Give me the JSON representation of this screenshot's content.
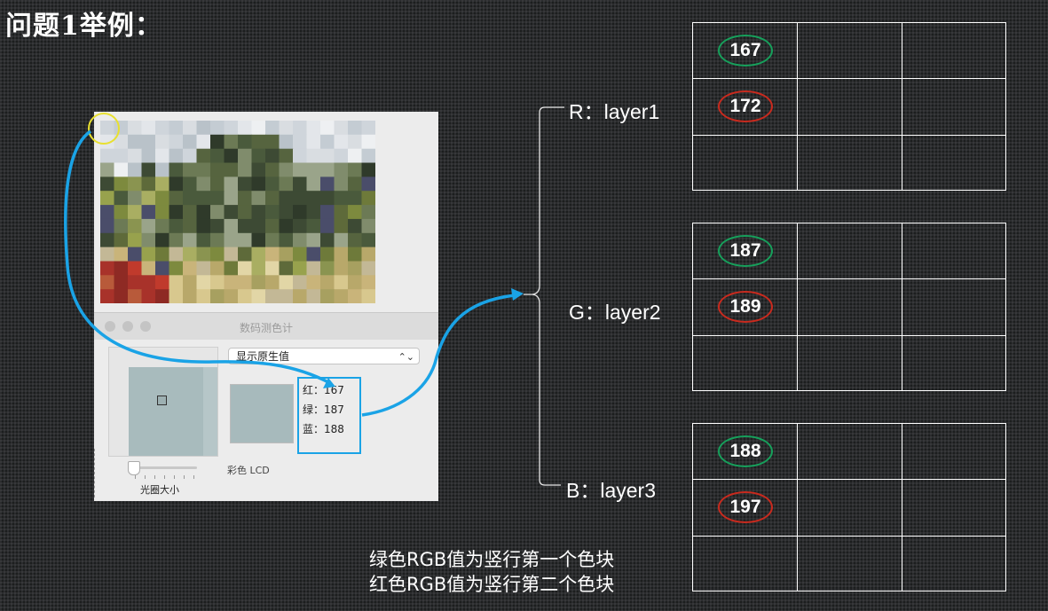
{
  "title": "问题1举例：",
  "meter": {
    "window_title": "数码测色计",
    "mode_select": "显示原生值",
    "red_line": "红：167",
    "green_line": "绿：187",
    "blue_line": "蓝：188",
    "aperture_label": "光圈大小",
    "display_label": "彩色 LCD"
  },
  "layers": [
    {
      "label": "R：layer1",
      "green_value": "167",
      "red_value": "172"
    },
    {
      "label": "G：layer2",
      "green_value": "187",
      "red_value": "189"
    },
    {
      "label": "B：layer3",
      "green_value": "188",
      "red_value": "197"
    }
  ],
  "captions": {
    "line1": "绿色RGB值为竖行第一个色块",
    "line2": "红色RGB值为竖行第二个色块"
  },
  "colors": {
    "green_ellipse": "#16a05b",
    "red_ellipse": "#c92a1e",
    "arrow": "#1aa3e6",
    "highlight_circle": "#e8e030",
    "sample_color": "#a7babc"
  },
  "icons": [
    "select-chevron-icon",
    "arrow-icon",
    "brace-icon"
  ]
}
